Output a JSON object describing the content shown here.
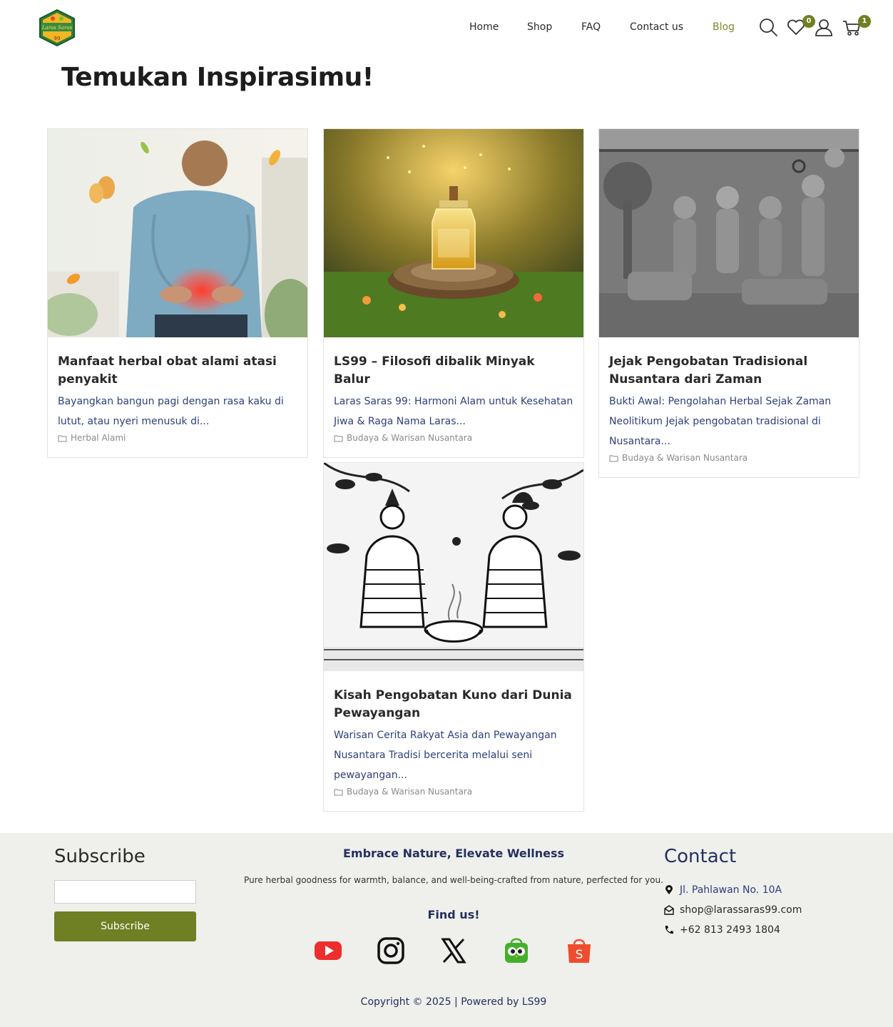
{
  "header": {
    "logo_text": "Laras Saras 99",
    "nav": [
      {
        "label": "Home"
      },
      {
        "label": "Shop"
      },
      {
        "label": "FAQ"
      },
      {
        "label": "Contact us"
      },
      {
        "label": "Blog",
        "active": true
      }
    ],
    "wishlist_count": "0",
    "cart_count": "1"
  },
  "page_title": "Temukan Inspirasimu!",
  "posts": [
    {
      "title": "Manfaat herbal obat alami atasi penyakit",
      "excerpt": "Bayangkan bangun pagi dengan rasa kaku di lutut, atau nyeri menusuk di...",
      "category": "Herbal Alami",
      "image": "man-back-pain-photo"
    },
    {
      "title": "LS99 – Filosofi dibalik Minyak Balur",
      "excerpt": "Laras Saras 99: Harmoni Alam untuk Kesehatan Jiwa & Raga Nama Laras...",
      "category": "Budaya & Warisan Nusantara",
      "image": "oil-bottle-photo"
    },
    {
      "title": "Jejak Pengobatan Tradisional Nusantara dari Zaman",
      "excerpt": "Bukti Awal: Pengolahan Herbal Sejak Zaman Neolitikum Jejak pengobatan tradisional di Nusantara...",
      "category": "Budaya & Warisan Nusantara",
      "image": "temple-relief-photo"
    },
    {
      "title": "Kisah Pengobatan Kuno dari Dunia Pewayangan",
      "excerpt": "Warisan Cerita Rakyat Asia dan Pewayangan Nusantara Tradisi bercerita melalui seni pewayangan...",
      "category": "Budaya & Warisan Nusantara",
      "image": "wayang-illustration"
    }
  ],
  "footer": {
    "subscribe_title": "Subscribe",
    "subscribe_button": "Subscribe",
    "tagline": "Embrace Nature, Elevate Wellness",
    "tagline_desc": "Pure herbal goodness for warmth, balance, and well-being-crafted from nature, perfected for you.",
    "find_us": "Find us!",
    "social": [
      "youtube-icon",
      "instagram-icon",
      "x-icon",
      "tokopedia-icon",
      "shopee-icon"
    ],
    "contact_title": "Contact",
    "address": "Jl. Pahlawan No. 10A",
    "email": "shop@larassaras99.com",
    "phone": "+62 813 2493 1804",
    "copyright": "Copyright © 2025 | Powered by LS99"
  },
  "colors": {
    "accent": "#6f7f23",
    "link": "#2e3f7a",
    "heading_dark_blue": "#24305e",
    "footer_bg": "#efefec"
  }
}
